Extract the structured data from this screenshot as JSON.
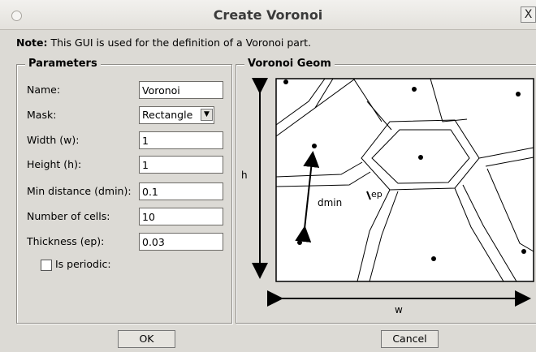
{
  "window": {
    "title": "Create Voronoi",
    "close_label": "X"
  },
  "note": {
    "prefix": "Note:",
    "text": "This GUI is used for the definition of a Voronoi part."
  },
  "parameters": {
    "title": "Parameters",
    "name": {
      "label": "Name:",
      "value": "Voronoi"
    },
    "mask": {
      "label": "Mask:",
      "value": "Rectangle"
    },
    "width": {
      "label": "Width (w):",
      "value": "1"
    },
    "height": {
      "label": "Height (h):",
      "value": "1"
    },
    "min_distance": {
      "label": "Min distance (dmin):",
      "value": "0.1"
    },
    "num_cells": {
      "label": "Number of cells:",
      "value": "10"
    },
    "thickness": {
      "label": "Thickness (ep):",
      "value": "0.03"
    },
    "periodic": {
      "label": "Is periodic:",
      "checked": false
    }
  },
  "geom": {
    "title": "Voronoi Geom",
    "w_label": "w",
    "h_label": "h",
    "dmin_label": "dmin",
    "ep_label": "ep"
  },
  "buttons": {
    "ok": "OK",
    "cancel": "Cancel"
  },
  "icons": {
    "dropdown": "chevron-down-icon",
    "close": "close-icon"
  }
}
